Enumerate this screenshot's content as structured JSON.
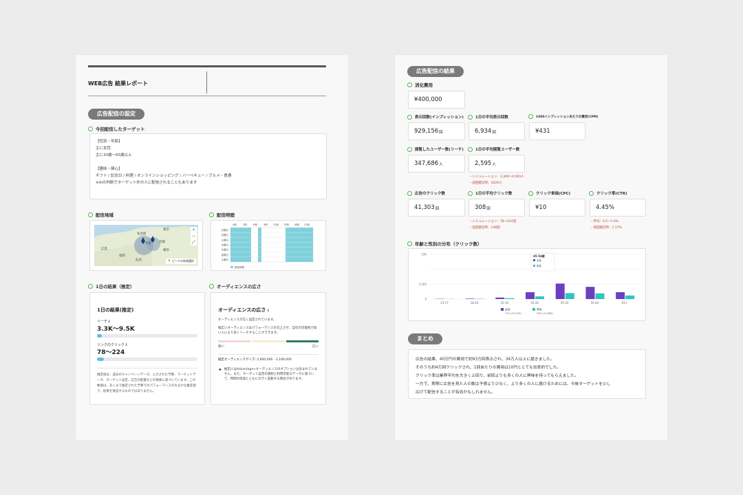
{
  "left": {
    "report_title": "WEB広告 結果レポート",
    "settings_pill": "広告配信の設定",
    "target_heading": "今回配信したターゲット",
    "target_lines": [
      "【性別・年齢】",
      "主に女性",
      "主に30歳〜65歳以上",
      "",
      "【趣味・関心】",
      "ギフト / 記念日 / 料理 / オンラインショッピング / バーベキュー / グルメ・食通",
      "※Aiの判断でターゲット外の人に配信されることもあります"
    ],
    "area_heading": "配信地域",
    "map_labels": [
      "名古屋",
      "東京",
      "大阪",
      "京都",
      "広島",
      "福岡",
      "横浜",
      "仙台"
    ],
    "map_link": "ピンでの地域選択",
    "time_heading": "配信時間",
    "time_hours": [
      "0時",
      "3時",
      "6時",
      "9時",
      "12時",
      "15時",
      "18時",
      "21時"
    ],
    "time_days": [
      "日曜日",
      "月曜日",
      "火曜日",
      "水曜日",
      "木曜日",
      "金曜日",
      "土曜日"
    ],
    "time_legend": "配信時間",
    "daily_heading": "1日の結果（推定）",
    "daily_title": "1日の結果(推定)",
    "reach_label": "リーチ",
    "reach_value": "3.3K〜9.5K",
    "reach_fill": 0.05,
    "click_label": "リンクのクリック",
    "click_value": "78〜224",
    "click_fill": 0.07,
    "daily_note": "推定値は、過去のキャンペーンデータ、入力された予算、マーケットデータ、ターゲット設定、広告の配置などの要素に基づいています。この数値は、あくまで推定された予算でのパフォーマンスの大まかな推定値で、結果を保証するものではありません。",
    "audience_heading": "オーディエンスの広さ",
    "audience_title": "オーディエンスの広さ",
    "audience_line1": "オーディエンスが広く設定されています。",
    "audience_line2": "幅広いオーディエンスはパフォーマンスを向上させ、自社の可能性が高い人により多くリーチすることができます。",
    "narrow_label": "狭い",
    "wide_label": "広い",
    "audience_size": "推定オーディエンスサイズ: 2,600,000 - 3,100,000",
    "audience_note": "推定にはAdvantage+オーディエンスのオプションは含まれていません。また、ターゲット設定の選択と利用可能なデータに基づいて、時間の経過とともに大きく変動する場合があります。"
  },
  "right": {
    "results_pill": "広告配信の結果",
    "spend": {
      "label": "消化費用",
      "value": "¥400,000"
    },
    "impressions": {
      "label": "表示回数(インプレッション)",
      "value": "929,156",
      "unit": "回"
    },
    "daily_impr": {
      "label": "1日の平均表示回数",
      "value": "6,934",
      "unit": "回"
    },
    "cpm": {
      "label": "1000インプレッションあたりの費用(CPM)",
      "value": "¥431"
    },
    "reach": {
      "label": "閲覧したユーザー数(リーチ)",
      "value": "347,686",
      "unit": "人"
    },
    "daily_users": {
      "label": "1日の平均閲覧ユーザー数",
      "value": "2,595",
      "unit": "人",
      "notes": [
        "・シミュレーション：3,300〜9,500人",
        "・前回配信時：3020人"
      ]
    },
    "clicks": {
      "label": "広告のクリック数",
      "value": "41,303",
      "unit": "回"
    },
    "daily_clicks": {
      "label": "1日の平均クリック数",
      "value": "308",
      "unit": "回",
      "notes": [
        "・シミュレーション：78〜224回",
        "・前回配信時：148回"
      ]
    },
    "cpc": {
      "label": "クリック単価(CPC)",
      "value": "¥10"
    },
    "ctr": {
      "label": "クリック率(CTR)",
      "value": "4.45%",
      "notes": [
        "・平均：0.5〜1.0%",
        "・前回配信時：2.17%"
      ]
    },
    "dist_heading": "年齢と性別の分布（クリック数）",
    "summary_pill": "まとめ",
    "summary_lines": [
      "広告の結果、40万円の費用で約93万回表示され、34万人以上に届きました。",
      "そのうち約4万回クリックされ、1回あたりの費用は10円ととても効率的でした。",
      "クリック率は業界平均を大きく上回り、前回よりも多くの人に興味を持ってもらえました。",
      "一方で、実際に広告を見た人の数は予想より少なく、より多くの人に届けるためには、今後ターゲットを少し",
      "広げて配信することが有効かもしれません。"
    ]
  },
  "chart_data": {
    "type": "bar",
    "categories": [
      "13-17",
      "18-24",
      "25-34",
      "35-44",
      "45-54",
      "55-64",
      "65+"
    ],
    "series": [
      {
        "name": "女性",
        "values": [
          80,
          150,
          500,
          2300,
          5200,
          4100,
          2300
        ],
        "color": "#6a40c0"
      },
      {
        "name": "男性",
        "values": [
          60,
          100,
          300,
          900,
          2000,
          1900,
          1200
        ],
        "color": "#2ec4c4"
      }
    ],
    "yticks": [
      "0",
      "5,000",
      "",
      "10K"
    ],
    "ylim": [
      0,
      15000
    ],
    "tooltip": {
      "title": "45-54歳",
      "lines": [
        "女性",
        "男性"
      ]
    },
    "legend": [
      {
        "label": "女性",
        "sub": "71% (29,135)"
      },
      {
        "label": "男性",
        "sub": "29% (12,088)"
      }
    ]
  }
}
